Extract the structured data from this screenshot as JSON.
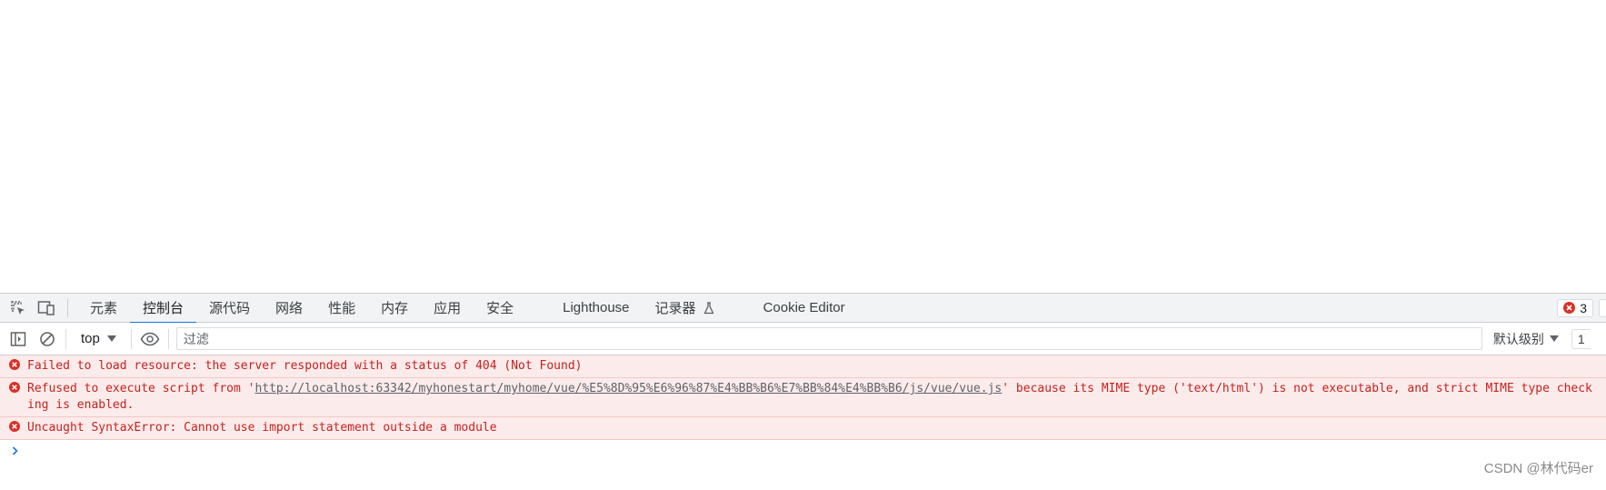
{
  "devtools": {
    "tabs": [
      {
        "label": "元素"
      },
      {
        "label": "控制台"
      },
      {
        "label": "源代码"
      },
      {
        "label": "网络"
      },
      {
        "label": "性能"
      },
      {
        "label": "内存"
      },
      {
        "label": "应用"
      },
      {
        "label": "安全"
      },
      {
        "label": "Lighthouse"
      },
      {
        "label": "记录器"
      },
      {
        "label": "Cookie Editor"
      }
    ],
    "active_tab": "控制台",
    "error_badge_count": "3"
  },
  "console_toolbar": {
    "context": "top",
    "filter_placeholder": "过滤",
    "levels_label": "默认级别",
    "issues_partial": "1"
  },
  "messages": [
    {
      "text": "Failed to load resource: the server responded with a status of 404 (Not Found)"
    },
    {
      "before": "Refused to execute script from '",
      "link": "http://localhost:63342/myhonestart/myhome/vue/%E5%8D%95%E6%96%87%E4%BB%B6%E7%BB%84%E4%BB%B6/js/vue/vue.js",
      "after": "' because its MIME type ('text/html') is not executable, and strict MIME type checking is enabled."
    },
    {
      "text": "Uncaught SyntaxError: Cannot use import statement outside a module"
    }
  ],
  "watermark": "CSDN @林代码er",
  "colors": {
    "error_text": "#c5221f",
    "error_bg": "#fcebeb",
    "active_tab_underline": "#1a73e8",
    "prompt": "#1a73e8"
  }
}
